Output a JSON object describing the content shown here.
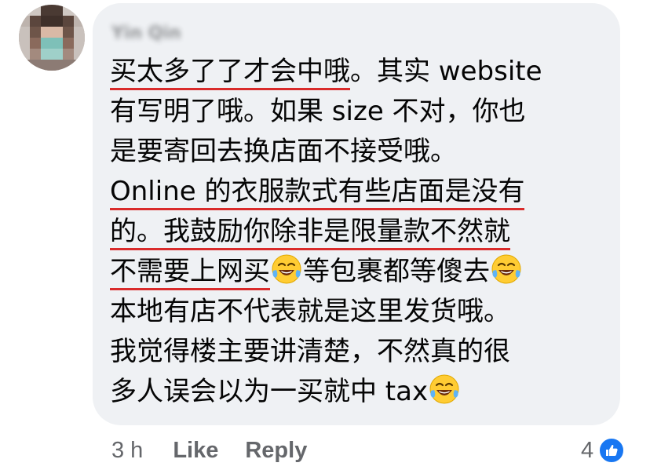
{
  "comment": {
    "author": "Yin Qin",
    "lines": [
      {
        "highlight": "买太多了了才会中哦",
        "rest": "。其实 website"
      },
      {
        "text": "有写明了哦。如果 size 不对，你也"
      },
      {
        "text": "是要寄回去换店面不接受哦。"
      },
      {
        "highlight": "Online 的衣服款式有些店面是没有"
      },
      {
        "highlight": "的。我鼓励你除非是限量款不然就"
      },
      {
        "highlight": "不需要上网买",
        "emoji_after": "joy-emoji",
        "rest": "等包裹都等傻去",
        "emoji_end": "joy-emoji"
      },
      {
        "text": "本地有店不代表就是这里发货哦。"
      },
      {
        "text": "我觉得楼主要讲清楚，不然真的很"
      },
      {
        "text": "多人误会以为一买就中 tax",
        "emoji_end": "joy-emoji"
      }
    ]
  },
  "footer": {
    "timestamp": "3 h",
    "like_label": "Like",
    "reply_label": "Reply",
    "reaction_count": "4",
    "reaction_icon": "thumbs-up-icon"
  },
  "colors": {
    "bubble": "#eff1f4",
    "highlight_underline": "#d92b2b",
    "action_text": "#65676b",
    "like_badge": "#1877f2"
  }
}
